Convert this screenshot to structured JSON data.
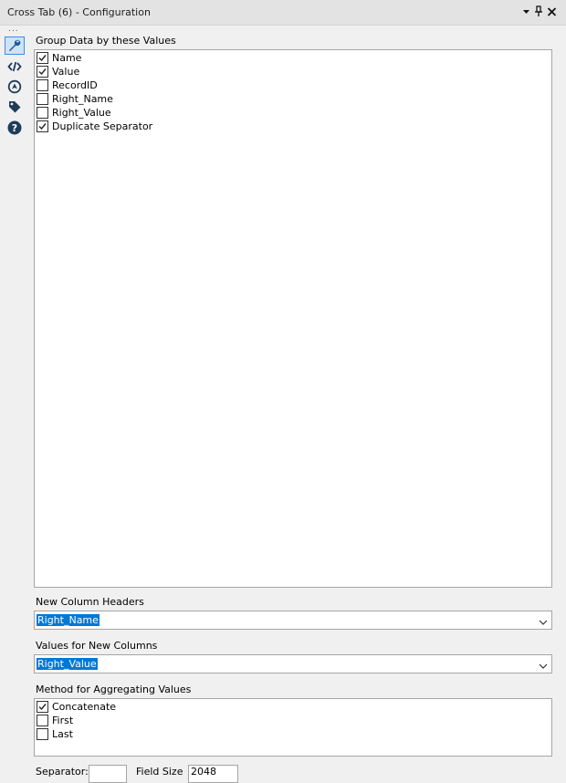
{
  "window": {
    "title": "Cross Tab (6) - Configuration",
    "controls": [
      "dropdown-arrow-icon",
      "pin-icon",
      "close-icon"
    ]
  },
  "sidebar": {
    "overflow_label": "...",
    "items": [
      {
        "icon": "wrench-icon",
        "active": true
      },
      {
        "icon": "code-icon",
        "active": false
      },
      {
        "icon": "annotation-icon",
        "active": false
      },
      {
        "icon": "tag-icon",
        "active": false
      },
      {
        "icon": "help-icon",
        "active": false
      }
    ]
  },
  "group_by": {
    "label": "Group Data by these Values",
    "fields": [
      {
        "label": "Name",
        "checked": true
      },
      {
        "label": "Value",
        "checked": true
      },
      {
        "label": "RecordID",
        "checked": false
      },
      {
        "label": "Right_Name",
        "checked": false
      },
      {
        "label": "Right_Value",
        "checked": false
      },
      {
        "label": "Duplicate Separator",
        "checked": true
      }
    ]
  },
  "new_column_headers": {
    "label": "New Column Headers",
    "value": "Right_Name"
  },
  "values_for_new_columns": {
    "label": "Values for New Columns",
    "value": "Right_Value"
  },
  "aggregation": {
    "label": "Method for Aggregating Values",
    "methods": [
      {
        "label": "Concatenate",
        "checked": true
      },
      {
        "label": "First",
        "checked": false
      },
      {
        "label": "Last",
        "checked": false
      }
    ]
  },
  "bottom_row": {
    "separator_label": "Separator:",
    "field_size_label": "Field Size",
    "field_size_value": "2048"
  }
}
